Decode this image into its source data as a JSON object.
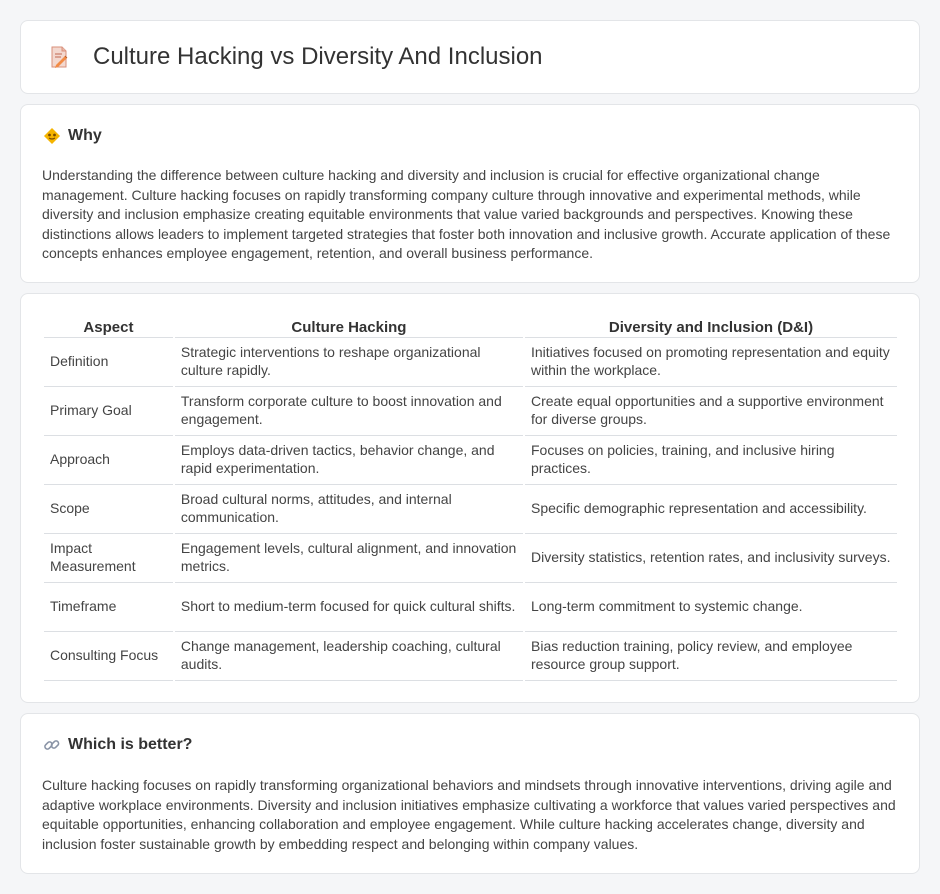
{
  "header": {
    "title": "Culture Hacking vs Diversity And Inclusion",
    "icon": "document-pencil-icon"
  },
  "why": {
    "title": "Why",
    "icon": "light-bulb-icon",
    "body": "Understanding the difference between culture hacking and diversity and inclusion is crucial for effective organizational change management. Culture hacking focuses on rapidly transforming company culture through innovative and experimental methods, while diversity and inclusion emphasize creating equitable environments that value varied backgrounds and perspectives. Knowing these distinctions allows leaders to implement targeted strategies that foster both innovation and inclusive growth. Accurate application of these concepts enhances employee engagement, retention, and overall business performance."
  },
  "comparison": {
    "headers": [
      "Aspect",
      "Culture Hacking",
      "Diversity and Inclusion (D&I)"
    ],
    "rows": [
      [
        "Definition",
        "Strategic interventions to reshape organizational culture rapidly.",
        "Initiatives focused on promoting representation and equity within the workplace."
      ],
      [
        "Primary Goal",
        "Transform corporate culture to boost innovation and engagement.",
        "Create equal opportunities and a supportive environment for diverse groups."
      ],
      [
        "Approach",
        "Employs data-driven tactics, behavior change, and rapid experimentation.",
        "Focuses on policies, training, and inclusive hiring practices."
      ],
      [
        "Scope",
        "Broad cultural norms, attitudes, and internal communication.",
        "Specific demographic representation and accessibility."
      ],
      [
        "Impact Measurement",
        "Engagement levels, cultural alignment, and innovation metrics.",
        "Diversity statistics, retention rates, and inclusivity surveys."
      ],
      [
        "Timeframe",
        "Short to medium-term focused for quick cultural shifts.",
        "Long-term commitment to systemic change."
      ],
      [
        "Consulting Focus",
        "Change management, leadership coaching, cultural audits.",
        "Bias reduction training, policy review, and employee resource group support."
      ]
    ]
  },
  "better": {
    "title": "Which is better?",
    "icon": "link-icon",
    "body": "Culture hacking focuses on rapidly transforming organizational behaviors and mindsets through innovative interventions, driving agile and adaptive workplace environments. Diversity and inclusion initiatives emphasize cultivating a workforce that values varied perspectives and equitable opportunities, enhancing collaboration and employee engagement. While culture hacking accelerates change, diversity and inclusion foster sustainable growth by embedding respect and belonging within company values."
  },
  "colors": {
    "background": "#f5f6f8",
    "card": "#ffffff",
    "border": "#e3e5e8",
    "text": "#444444"
  }
}
